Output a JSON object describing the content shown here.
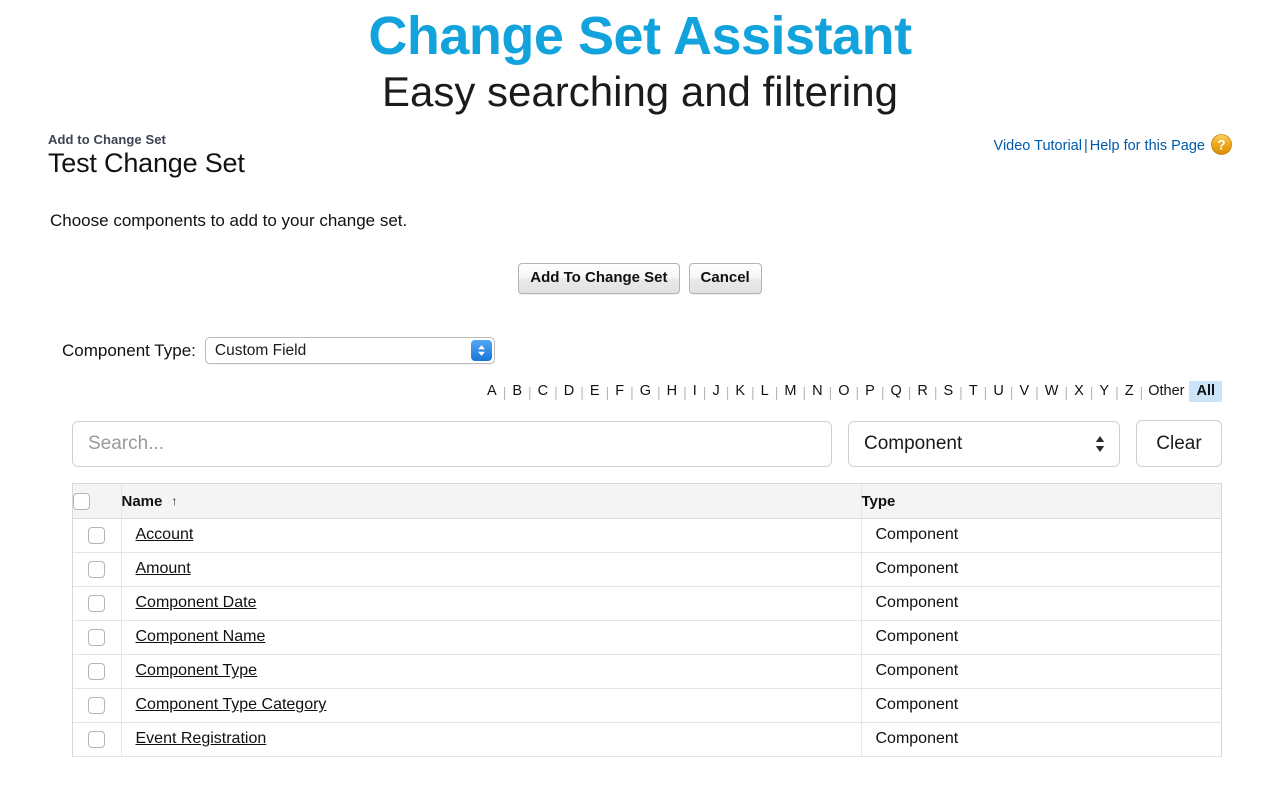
{
  "promo": {
    "title": "Change Set Assistant",
    "subtitle": "Easy searching and filtering",
    "title_color": "#12a3dc"
  },
  "header": {
    "eyebrow": "Add to Change Set",
    "title": "Test Change Set",
    "video_tutorial_label": "Video Tutorial",
    "separator": "|",
    "help_label": "Help for this Page",
    "help_icon": "question-circle-icon",
    "help_icon_color": "#e8a317"
  },
  "intro": "Choose components to add to your change set.",
  "actions": {
    "primary_label": "Add To Change Set",
    "cancel_label": "Cancel"
  },
  "component_type_filter": {
    "label": "Component Type:",
    "selected": "Custom Field",
    "stepper_icon": "chevron-up-down-icon",
    "stepper_color": "#1874d8"
  },
  "alphabet_filter": {
    "letters": [
      "A",
      "B",
      "C",
      "D",
      "E",
      "F",
      "G",
      "H",
      "I",
      "J",
      "K",
      "L",
      "M",
      "N",
      "O",
      "P",
      "Q",
      "R",
      "S",
      "T",
      "U",
      "V",
      "W",
      "X",
      "Y",
      "Z"
    ],
    "other_label": "Other",
    "all_label": "All",
    "selected": "All",
    "selected_bg": "#cbe4f9"
  },
  "toolbar": {
    "search_placeholder": "Search...",
    "search_value": "",
    "scope_selected": "Component",
    "scope_stepper_icon": "triangle-up-down-icon",
    "clear_label": "Clear"
  },
  "table": {
    "columns": [
      {
        "key": "check",
        "label": ""
      },
      {
        "key": "name",
        "label": "Name",
        "sort": "ascending",
        "sort_icon": "arrow-up-icon"
      },
      {
        "key": "type",
        "label": "Type"
      }
    ],
    "select_all_checked": false,
    "rows": [
      {
        "name": "Account",
        "type": "Component",
        "checked": false
      },
      {
        "name": "Amount",
        "type": "Component",
        "checked": false
      },
      {
        "name": "Component Date",
        "type": "Component",
        "checked": false
      },
      {
        "name": "Component Name",
        "type": "Component",
        "checked": false
      },
      {
        "name": "Component Type",
        "type": "Component",
        "checked": false
      },
      {
        "name": "Component Type Category",
        "type": "Component",
        "checked": false
      },
      {
        "name": "Event Registration",
        "type": "Component",
        "checked": false
      }
    ]
  }
}
